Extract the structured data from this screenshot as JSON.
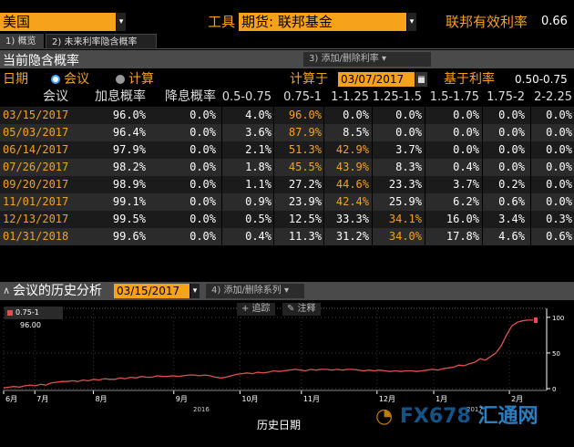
{
  "topbar": {
    "country": "美国",
    "tools_label": "工具",
    "instrument": "期货: 联邦基金",
    "fed_rate_label": "联邦有效利率",
    "fed_rate_value": "0.66"
  },
  "tabs": [
    {
      "label": "1) 概览"
    },
    {
      "label": "2) 未来利率隐含概率"
    }
  ],
  "section1": {
    "title": "当前隐含概率",
    "add_remove_rate": "3) 添加/删除利率 ▾"
  },
  "controls": {
    "date_label": "日期",
    "meeting_label": "会议",
    "calc_label": "计算",
    "calc_on_label": "计算于",
    "calc_date": "03/07/2017",
    "based_on_label": "基于利率",
    "based_on_value": "0.50-0.75"
  },
  "table": {
    "headers": [
      "会议",
      "加息概率",
      "降息概率",
      "0.5-0.75",
      "0.75-1",
      "1-1.25",
      "1.25-1.5",
      "1.5-1.75",
      "1.75-2",
      "2-2.25"
    ],
    "rows": [
      [
        "03/15/2017",
        "96.0%",
        "0.0%",
        "4.0%",
        "96.0%",
        "0.0%",
        "0.0%",
        "0.0%",
        "0.0%",
        "0.0%"
      ],
      [
        "05/03/2017",
        "96.4%",
        "0.0%",
        "3.6%",
        "87.9%",
        "8.5%",
        "0.0%",
        "0.0%",
        "0.0%",
        "0.0%"
      ],
      [
        "06/14/2017",
        "97.9%",
        "0.0%",
        "2.1%",
        "51.3%",
        "42.9%",
        "3.7%",
        "0.0%",
        "0.0%",
        "0.0%"
      ],
      [
        "07/26/2017",
        "98.2%",
        "0.0%",
        "1.8%",
        "45.5%",
        "43.9%",
        "8.3%",
        "0.4%",
        "0.0%",
        "0.0%"
      ],
      [
        "09/20/2017",
        "98.9%",
        "0.0%",
        "1.1%",
        "27.2%",
        "44.6%",
        "23.3%",
        "3.7%",
        "0.2%",
        "0.0%"
      ],
      [
        "11/01/2017",
        "99.1%",
        "0.0%",
        "0.9%",
        "23.9%",
        "42.4%",
        "25.9%",
        "6.2%",
        "0.6%",
        "0.0%"
      ],
      [
        "12/13/2017",
        "99.5%",
        "0.0%",
        "0.5%",
        "12.5%",
        "33.3%",
        "34.1%",
        "16.0%",
        "3.4%",
        "0.3%"
      ],
      [
        "01/31/2018",
        "99.6%",
        "0.0%",
        "0.4%",
        "11.3%",
        "31.2%",
        "34.0%",
        "17.8%",
        "4.6%",
        "0.6%"
      ]
    ],
    "highlight": [
      [
        0,
        4
      ],
      [
        1,
        4
      ],
      [
        2,
        4
      ],
      [
        2,
        5
      ],
      [
        3,
        4
      ],
      [
        3,
        5
      ],
      [
        4,
        5
      ],
      [
        5,
        5
      ],
      [
        6,
        6
      ],
      [
        7,
        6
      ]
    ]
  },
  "section2": {
    "title": "会议的历史分析",
    "date": "03/15/2017",
    "add_remove_series": "4) 添加/删除系列 ▾"
  },
  "chart_buttons": {
    "track": "+ 追踪",
    "annotate": "✎ 注释"
  },
  "watermark": {
    "brand": "FX678",
    "brand_cn": "汇通网"
  },
  "chart_data": {
    "type": "line",
    "xlabel": "历史日期",
    "legend": [
      {
        "name": "0.75-1",
        "value": "96.00"
      }
    ],
    "yticks": [
      0,
      50,
      100
    ],
    "ylim": [
      0,
      110
    ],
    "x_tick_labels": [
      "6月",
      "7月",
      "8月",
      "9月",
      "10月",
      "11月",
      "12月",
      "1月",
      "2月"
    ],
    "year_labels": [
      "2016",
      "2017"
    ],
    "series": [
      {
        "name": "0.75-1",
        "color": "#e05050",
        "x": [
          0,
          3,
          6,
          9,
          12,
          15,
          18,
          21,
          24,
          27,
          30,
          33,
          36,
          39,
          42,
          45,
          48,
          51,
          54,
          57,
          60,
          63,
          66,
          69,
          72,
          75,
          78,
          81,
          84,
          87,
          90,
          93,
          96,
          99,
          102,
          105,
          108,
          111,
          114,
          117,
          120,
          123,
          126,
          129,
          132,
          135,
          138,
          141,
          144,
          147,
          150,
          153,
          156,
          159,
          162,
          165,
          168,
          171,
          174,
          177,
          180,
          183,
          186,
          189,
          192,
          195,
          198,
          201,
          204,
          207,
          210,
          213,
          216,
          219,
          222,
          225,
          228,
          231,
          234,
          237,
          240,
          243,
          246,
          249,
          252,
          255,
          258,
          261,
          264,
          267,
          270,
          273,
          276,
          279,
          282,
          285,
          288,
          291,
          294,
          297,
          300
        ],
        "values": [
          1,
          2,
          3,
          2,
          4,
          5,
          4,
          6,
          5,
          8,
          9,
          10,
          10,
          11,
          10,
          12,
          11,
          13,
          12,
          14,
          13,
          13,
          15,
          14,
          16,
          15,
          17,
          16,
          16,
          18,
          17,
          17,
          18,
          17,
          18,
          19,
          19,
          18,
          19,
          18,
          16,
          15,
          16,
          18,
          20,
          21,
          22,
          21,
          23,
          22,
          23,
          25,
          24,
          25,
          26,
          27,
          26,
          25,
          27,
          26,
          27,
          27,
          26,
          27,
          26,
          27,
          27,
          26,
          25,
          26,
          25,
          26,
          25,
          24,
          25,
          24,
          25,
          25,
          24,
          25,
          26,
          27,
          26,
          28,
          29,
          30,
          33,
          32,
          35,
          37,
          42,
          40,
          45,
          50,
          60,
          75,
          88,
          93,
          95,
          96,
          96
        ]
      }
    ]
  }
}
